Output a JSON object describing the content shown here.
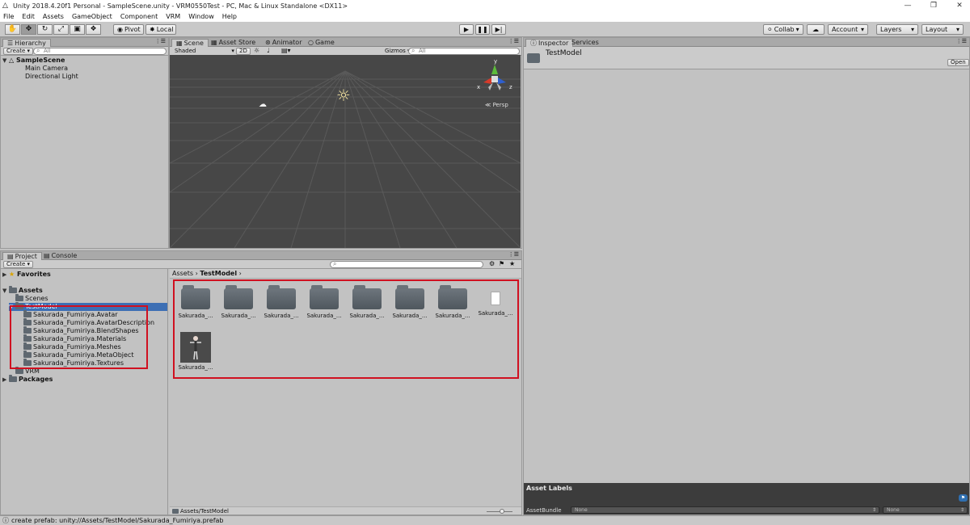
{
  "window": {
    "title": "Unity 2018.4.20f1 Personal - SampleScene.unity - VRM0550Test - PC, Mac & Linux Standalone <DX11>"
  },
  "menu": [
    "File",
    "Edit",
    "Assets",
    "GameObject",
    "Component",
    "VRM",
    "Window",
    "Help"
  ],
  "toolbar": {
    "pivot_label": "Pivot",
    "local_label": "Local",
    "collab_label": "Collab",
    "account_label": "Account",
    "layers_label": "Layers",
    "layout_label": "Layout"
  },
  "hierarchy": {
    "tab_label": "Hierarchy",
    "create_label": "Create",
    "search_placeholder": "All",
    "scene_name": "SampleScene",
    "items": [
      "Main Camera",
      "Directional Light"
    ]
  },
  "scene": {
    "tabs": [
      "Scene",
      "Asset Store",
      "Animator",
      "Game"
    ],
    "shading_mode": "Shaded",
    "mode_2d": "2D",
    "gizmos_label": "Gizmos",
    "search_placeholder": "All",
    "axis_labels": {
      "y": "y",
      "x": "x",
      "z": "z"
    },
    "projection_label": "Persp"
  },
  "inspector": {
    "tabs": [
      "Inspector",
      "Services"
    ],
    "object_name": "TestModel",
    "open_label": "Open",
    "asset_labels_title": "Asset Labels",
    "asset_bundle_label": "AssetBundle",
    "bundle_value": "None",
    "variant_value": "None"
  },
  "project": {
    "tabs": [
      "Project",
      "Console"
    ],
    "create_label": "Create",
    "favorites_label": "Favorites",
    "assets_label": "Assets",
    "scenes_label": "Scenes",
    "testmodel_label": "TestModel",
    "subfolders": [
      "Sakurada_Fumiriya.Avatar",
      "Sakurada_Fumiriya.AvatarDescription",
      "Sakurada_Fumiriya.BlendShapes",
      "Sakurada_Fumiriya.Materials",
      "Sakurada_Fumiriya.Meshes",
      "Sakurada_Fumiriya.MetaObject",
      "Sakurada_Fumiriya.Textures"
    ],
    "vrm_label": "VRM",
    "packages_label": "Packages",
    "breadcrumb_root": "Assets",
    "breadcrumb_current": "TestModel",
    "grid_items": [
      "Sakurada_...",
      "Sakurada_...",
      "Sakurada_...",
      "Sakurada_...",
      "Sakurada_...",
      "Sakurada_...",
      "Sakurada_...",
      "Sakurada_...",
      "Sakurada_..."
    ],
    "footer_path": "Assets/TestModel"
  },
  "status": {
    "message": "create prefab: unity://Assets/TestModel/Sakurada_Fumiriya.prefab"
  },
  "colors": {
    "highlight_box": "#d01020",
    "scene_background": "#474747",
    "axis_y": "#5dbb3a",
    "axis_x": "#d83a2a",
    "axis_z": "#2e5fd0"
  }
}
